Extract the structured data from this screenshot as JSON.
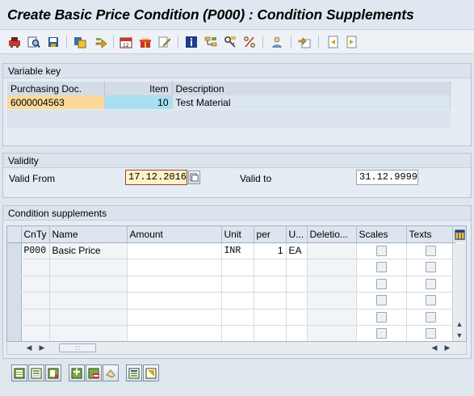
{
  "window": {
    "title": "Create Basic Price Condition (P000) : Condition Supplements"
  },
  "toolbar": {
    "icons": [
      "condition-icon",
      "document-search-icon",
      "save-local-icon",
      "copy-icon",
      "forward-arrow-icon",
      "calendar-icon",
      "gift-icon",
      "edit-icon",
      "info-icon",
      "hierarchy-icon",
      "key-icon",
      "percent-icon",
      "person-icon",
      "export-icon",
      "prev-page-icon",
      "next-page-icon"
    ]
  },
  "variable_key": {
    "section_title": "Variable key",
    "columns": {
      "doc": "Purchasing Doc.",
      "item": "Item",
      "desc": "Description"
    },
    "row": {
      "doc": "6000004563",
      "item": "10",
      "desc": "Test Material"
    }
  },
  "validity": {
    "section_title": "Validity",
    "valid_from_label": "Valid From",
    "valid_from_value": "17.12.2016",
    "valid_to_label": "Valid to",
    "valid_to_value": "31.12.9999"
  },
  "supplements": {
    "section_title": "Condition supplements",
    "columns": [
      "CnTy",
      "Name",
      "Amount",
      "Unit",
      "per",
      "U...",
      "Deletio...",
      "Scales",
      "Texts"
    ],
    "rows": [
      {
        "cnty": "P000",
        "name": "Basic Price",
        "amount": "",
        "unit": "INR",
        "per": "1",
        "uom": "EA"
      },
      {
        "cnty": "",
        "name": "",
        "amount": "",
        "unit": "",
        "per": "",
        "uom": ""
      },
      {
        "cnty": "",
        "name": "",
        "amount": "",
        "unit": "",
        "per": "",
        "uom": ""
      },
      {
        "cnty": "",
        "name": "",
        "amount": "",
        "unit": "",
        "per": "",
        "uom": ""
      },
      {
        "cnty": "",
        "name": "",
        "amount": "",
        "unit": "",
        "per": "",
        "uom": ""
      },
      {
        "cnty": "",
        "name": "",
        "amount": "",
        "unit": "",
        "per": "",
        "uom": ""
      }
    ],
    "hscroll_thumb": ":::"
  },
  "bottom_buttons": [
    "select-all-icon",
    "select-block-icon",
    "deselect-all-icon",
    "insert-row-icon",
    "delete-row-icon",
    "undo-icon",
    "details-icon",
    "choose-icon"
  ]
}
